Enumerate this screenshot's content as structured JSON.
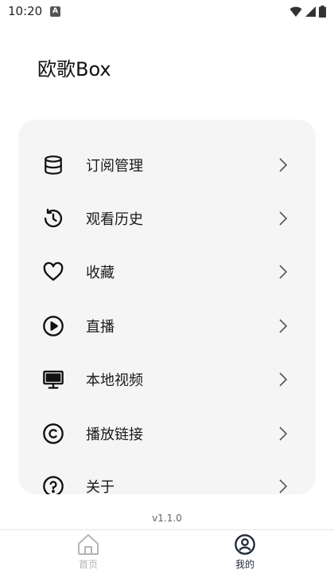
{
  "status": {
    "time": "10:20",
    "notification_glyph": "A"
  },
  "app": {
    "title": "欧歌Box"
  },
  "menu": {
    "items": [
      {
        "label": "订阅管理",
        "icon": "database-icon"
      },
      {
        "label": "观看历史",
        "icon": "history-icon"
      },
      {
        "label": "收藏",
        "icon": "heart-icon"
      },
      {
        "label": "直播",
        "icon": "play-circle-icon"
      },
      {
        "label": "本地视频",
        "icon": "monitor-icon"
      },
      {
        "label": "播放链接",
        "icon": "copyright-icon"
      },
      {
        "label": "关于",
        "icon": "help-circle-icon"
      }
    ]
  },
  "footer": {
    "version": "v1.1.0"
  },
  "nav": {
    "home_label": "首页",
    "me_label": "我的",
    "active_tab": "我的",
    "active_color": "#1f2937",
    "inactive_color": "#b5b5b5"
  },
  "colors": {
    "card_bg": "#f5f5f5",
    "page_bg": "#ffffff"
  }
}
